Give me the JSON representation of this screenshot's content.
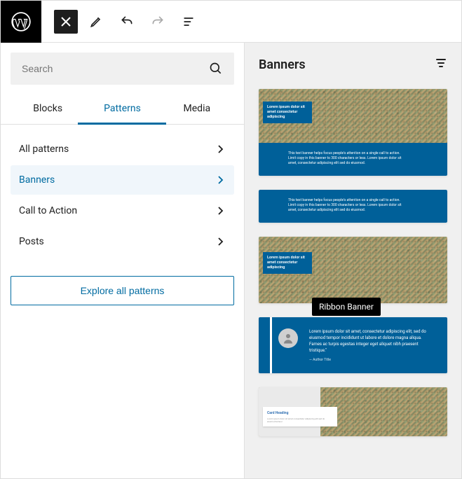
{
  "search": {
    "placeholder": "Search"
  },
  "tabs": {
    "blocks": "Blocks",
    "patterns": "Patterns",
    "media": "Media",
    "active": "patterns"
  },
  "categories": [
    {
      "label": "All patterns",
      "selected": false
    },
    {
      "label": "Banners",
      "selected": true
    },
    {
      "label": "Call to Action",
      "selected": false
    },
    {
      "label": "Posts",
      "selected": false
    }
  ],
  "explore_button": "Explore all patterns",
  "right": {
    "title": "Banners"
  },
  "tooltip": "Ribbon Banner",
  "previews": {
    "banner1": {
      "title": "Lorem ipsum dolor sit amet consectetur adipiscing",
      "desc1": "This text banner helps focus people's attention on a single call to action.",
      "desc2": "Limit copy in this banner to 300 characters or less. Lorem ipsum dolor sit",
      "desc3": "amet, consectetur adipiscing elit sed do eiusmod."
    },
    "banner2": {
      "desc1": "This text banner helps focus people's attention on a single call to action.",
      "desc2": "Limit copy in this banner to 300 characters or less. Lorem ipsum dolor sit",
      "desc3": "amet, consectetur adipiscing elit sed do eiusmod."
    },
    "banner3": {
      "title": "Lorem ipsum dolor sit amet consectetur adipiscing"
    },
    "banner4": {
      "quote": "Lorem ipsum dolor sit amet, consectetur adipiscing elit, sed do eiusmod tempor incididunt ut labore et dolore magna aliqua. Fames ac turpis egestas integer eget aliquet nibh praesent tristique.\"",
      "author": "— Author Title"
    },
    "banner5": {
      "heading": "Card Heading",
      "text": "Lorem ipsum dolor sit amet consectetur adipiscing elit sed do eiusmod tempor"
    }
  }
}
